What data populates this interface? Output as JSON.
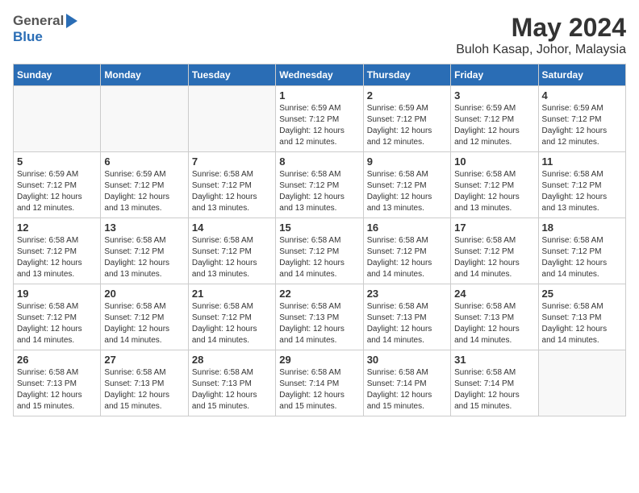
{
  "header": {
    "logo_general": "General",
    "logo_blue": "Blue",
    "month_title": "May 2024",
    "location": "Buloh Kasap, Johor, Malaysia"
  },
  "weekdays": [
    "Sunday",
    "Monday",
    "Tuesday",
    "Wednesday",
    "Thursday",
    "Friday",
    "Saturday"
  ],
  "weeks": [
    [
      {
        "day": "",
        "sunrise": "",
        "sunset": "",
        "daylight": "",
        "empty": true
      },
      {
        "day": "",
        "sunrise": "",
        "sunset": "",
        "daylight": "",
        "empty": true
      },
      {
        "day": "",
        "sunrise": "",
        "sunset": "",
        "daylight": "",
        "empty": true
      },
      {
        "day": "1",
        "sunrise": "Sunrise: 6:59 AM",
        "sunset": "Sunset: 7:12 PM",
        "daylight": "Daylight: 12 hours and 12 minutes."
      },
      {
        "day": "2",
        "sunrise": "Sunrise: 6:59 AM",
        "sunset": "Sunset: 7:12 PM",
        "daylight": "Daylight: 12 hours and 12 minutes."
      },
      {
        "day": "3",
        "sunrise": "Sunrise: 6:59 AM",
        "sunset": "Sunset: 7:12 PM",
        "daylight": "Daylight: 12 hours and 12 minutes."
      },
      {
        "day": "4",
        "sunrise": "Sunrise: 6:59 AM",
        "sunset": "Sunset: 7:12 PM",
        "daylight": "Daylight: 12 hours and 12 minutes."
      }
    ],
    [
      {
        "day": "5",
        "sunrise": "Sunrise: 6:59 AM",
        "sunset": "Sunset: 7:12 PM",
        "daylight": "Daylight: 12 hours and 12 minutes."
      },
      {
        "day": "6",
        "sunrise": "Sunrise: 6:59 AM",
        "sunset": "Sunset: 7:12 PM",
        "daylight": "Daylight: 12 hours and 13 minutes."
      },
      {
        "day": "7",
        "sunrise": "Sunrise: 6:58 AM",
        "sunset": "Sunset: 7:12 PM",
        "daylight": "Daylight: 12 hours and 13 minutes."
      },
      {
        "day": "8",
        "sunrise": "Sunrise: 6:58 AM",
        "sunset": "Sunset: 7:12 PM",
        "daylight": "Daylight: 12 hours and 13 minutes."
      },
      {
        "day": "9",
        "sunrise": "Sunrise: 6:58 AM",
        "sunset": "Sunset: 7:12 PM",
        "daylight": "Daylight: 12 hours and 13 minutes."
      },
      {
        "day": "10",
        "sunrise": "Sunrise: 6:58 AM",
        "sunset": "Sunset: 7:12 PM",
        "daylight": "Daylight: 12 hours and 13 minutes."
      },
      {
        "day": "11",
        "sunrise": "Sunrise: 6:58 AM",
        "sunset": "Sunset: 7:12 PM",
        "daylight": "Daylight: 12 hours and 13 minutes."
      }
    ],
    [
      {
        "day": "12",
        "sunrise": "Sunrise: 6:58 AM",
        "sunset": "Sunset: 7:12 PM",
        "daylight": "Daylight: 12 hours and 13 minutes."
      },
      {
        "day": "13",
        "sunrise": "Sunrise: 6:58 AM",
        "sunset": "Sunset: 7:12 PM",
        "daylight": "Daylight: 12 hours and 13 minutes."
      },
      {
        "day": "14",
        "sunrise": "Sunrise: 6:58 AM",
        "sunset": "Sunset: 7:12 PM",
        "daylight": "Daylight: 12 hours and 13 minutes."
      },
      {
        "day": "15",
        "sunrise": "Sunrise: 6:58 AM",
        "sunset": "Sunset: 7:12 PM",
        "daylight": "Daylight: 12 hours and 14 minutes."
      },
      {
        "day": "16",
        "sunrise": "Sunrise: 6:58 AM",
        "sunset": "Sunset: 7:12 PM",
        "daylight": "Daylight: 12 hours and 14 minutes."
      },
      {
        "day": "17",
        "sunrise": "Sunrise: 6:58 AM",
        "sunset": "Sunset: 7:12 PM",
        "daylight": "Daylight: 12 hours and 14 minutes."
      },
      {
        "day": "18",
        "sunrise": "Sunrise: 6:58 AM",
        "sunset": "Sunset: 7:12 PM",
        "daylight": "Daylight: 12 hours and 14 minutes."
      }
    ],
    [
      {
        "day": "19",
        "sunrise": "Sunrise: 6:58 AM",
        "sunset": "Sunset: 7:12 PM",
        "daylight": "Daylight: 12 hours and 14 minutes."
      },
      {
        "day": "20",
        "sunrise": "Sunrise: 6:58 AM",
        "sunset": "Sunset: 7:12 PM",
        "daylight": "Daylight: 12 hours and 14 minutes."
      },
      {
        "day": "21",
        "sunrise": "Sunrise: 6:58 AM",
        "sunset": "Sunset: 7:12 PM",
        "daylight": "Daylight: 12 hours and 14 minutes."
      },
      {
        "day": "22",
        "sunrise": "Sunrise: 6:58 AM",
        "sunset": "Sunset: 7:13 PM",
        "daylight": "Daylight: 12 hours and 14 minutes."
      },
      {
        "day": "23",
        "sunrise": "Sunrise: 6:58 AM",
        "sunset": "Sunset: 7:13 PM",
        "daylight": "Daylight: 12 hours and 14 minutes."
      },
      {
        "day": "24",
        "sunrise": "Sunrise: 6:58 AM",
        "sunset": "Sunset: 7:13 PM",
        "daylight": "Daylight: 12 hours and 14 minutes."
      },
      {
        "day": "25",
        "sunrise": "Sunrise: 6:58 AM",
        "sunset": "Sunset: 7:13 PM",
        "daylight": "Daylight: 12 hours and 14 minutes."
      }
    ],
    [
      {
        "day": "26",
        "sunrise": "Sunrise: 6:58 AM",
        "sunset": "Sunset: 7:13 PM",
        "daylight": "Daylight: 12 hours and 15 minutes."
      },
      {
        "day": "27",
        "sunrise": "Sunrise: 6:58 AM",
        "sunset": "Sunset: 7:13 PM",
        "daylight": "Daylight: 12 hours and 15 minutes."
      },
      {
        "day": "28",
        "sunrise": "Sunrise: 6:58 AM",
        "sunset": "Sunset: 7:13 PM",
        "daylight": "Daylight: 12 hours and 15 minutes."
      },
      {
        "day": "29",
        "sunrise": "Sunrise: 6:58 AM",
        "sunset": "Sunset: 7:14 PM",
        "daylight": "Daylight: 12 hours and 15 minutes."
      },
      {
        "day": "30",
        "sunrise": "Sunrise: 6:58 AM",
        "sunset": "Sunset: 7:14 PM",
        "daylight": "Daylight: 12 hours and 15 minutes."
      },
      {
        "day": "31",
        "sunrise": "Sunrise: 6:58 AM",
        "sunset": "Sunset: 7:14 PM",
        "daylight": "Daylight: 12 hours and 15 minutes."
      },
      {
        "day": "",
        "sunrise": "",
        "sunset": "",
        "daylight": "",
        "empty": true
      }
    ]
  ]
}
